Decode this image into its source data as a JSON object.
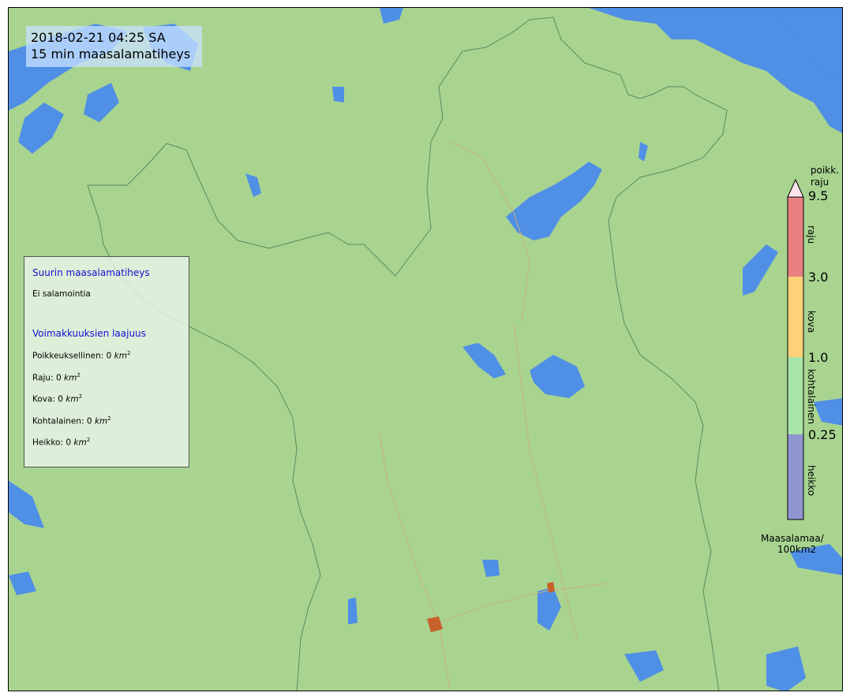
{
  "header": {
    "timestamp": "2018-02-21  04:25 SA",
    "product": "15 min maasalamatiheys"
  },
  "info_panel": {
    "max_density_heading": "Suurin maasalamatiheys",
    "max_density_value": "Ei salamointia",
    "extent_heading": "Voimakkuuksien laajuus",
    "extents": [
      {
        "label": "Poikkeuksellinen: 0",
        "value": 0
      },
      {
        "label": "Raju: 0",
        "value": 0
      },
      {
        "label": "Kova: 0",
        "value": 0
      },
      {
        "label": "Kohtalainen: 0",
        "value": 0
      },
      {
        "label": "Heikko: 0",
        "value": 0
      }
    ],
    "unit": "km",
    "unit_exponent": "2"
  },
  "colorbar": {
    "ticks": [
      "9.5",
      "3.0",
      "1.0",
      "0.25"
    ],
    "class_labels": [
      "raju",
      "kova",
      "kohtalainen",
      "heikko"
    ],
    "extend_label_line1": "poikk.",
    "extend_label_line2": "raju",
    "unit_line1": "Maasalamaa/",
    "unit_line2": "100km2",
    "colors": {
      "heikko": "#8f95d0",
      "kohtalainen": "#a8e4a8",
      "kova": "#ffd27a",
      "raju": "#e98080",
      "poikk": "#ffe4ec"
    }
  },
  "map": {
    "land_color": "#a8d490",
    "water_color": "#4f8fe6",
    "border_color": "#5c8a5c",
    "road_color": "#c9b27a",
    "city_color": "#c8602a"
  }
}
